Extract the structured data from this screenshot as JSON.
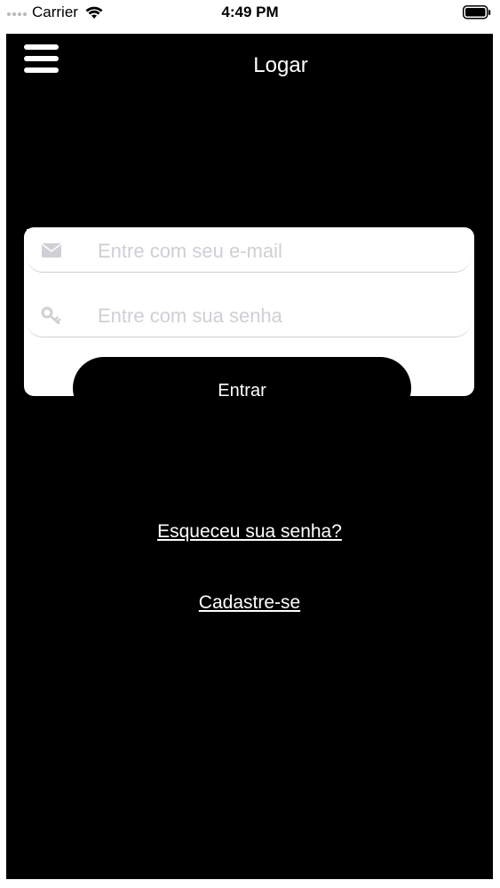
{
  "status_bar": {
    "carrier": "Carrier",
    "time": "4:49 PM",
    "wifi_icon": "wifi-icon",
    "battery_icon": "battery-icon"
  },
  "header": {
    "title": "Logar",
    "menu_icon": "hamburger-menu-icon"
  },
  "form": {
    "email": {
      "value": "",
      "placeholder": "Entre com seu e-mail",
      "icon": "envelope-icon"
    },
    "password": {
      "value": "",
      "placeholder": "Entre com sua senha",
      "icon": "key-icon"
    },
    "submit_label": "Entrar"
  },
  "links": {
    "forgot_password": "Esqueceu sua senha?",
    "signup": "Cadastre-se"
  },
  "colors": {
    "background": "#000000",
    "card": "#ffffff",
    "text": "#ffffff",
    "placeholder": "#cfcfd4"
  }
}
